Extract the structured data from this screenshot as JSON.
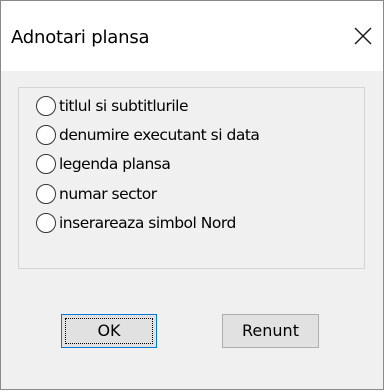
{
  "window": {
    "title": "Adnotari plansa"
  },
  "options": [
    {
      "label": "titlul si subtitlurile",
      "selected": false
    },
    {
      "label": "denumire executant si data",
      "selected": false
    },
    {
      "label": "legenda plansa",
      "selected": false
    },
    {
      "label": "numar sector",
      "selected": false
    },
    {
      "label": "inserareaza simbol Nord",
      "selected": false
    }
  ],
  "buttons": {
    "ok_label": "OK",
    "cancel_label": "Renunt"
  },
  "icons": {
    "close": "close-icon"
  }
}
